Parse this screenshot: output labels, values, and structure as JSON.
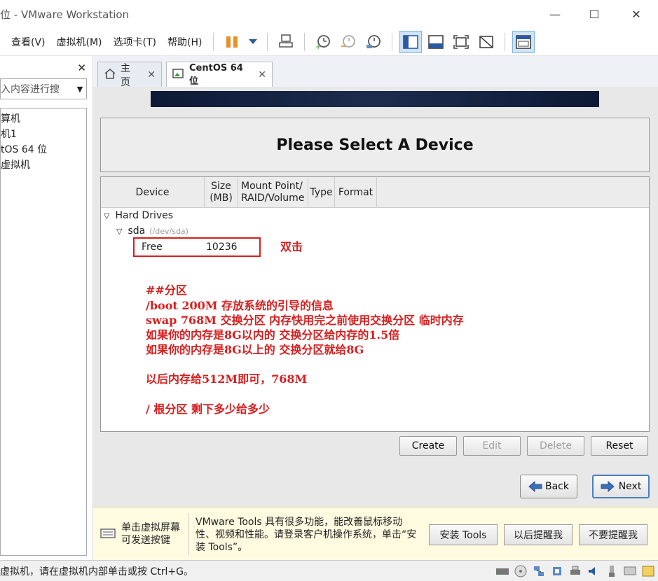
{
  "window": {
    "title": "位 - VMware Workstation",
    "minimize": "—",
    "maximize": "☐",
    "close": "✕"
  },
  "menu": [
    "查看(V)",
    "虚拟机(M)",
    "选项卡(T)",
    "帮助(H)"
  ],
  "library": {
    "search_placeholder": "入内容进行搜",
    "items": [
      "算机",
      "机1",
      "tOS 64 位",
      "虚拟机"
    ]
  },
  "tabs": [
    {
      "label": "主页"
    },
    {
      "label": "CentOS 64 位"
    }
  ],
  "installer": {
    "title": "Please Select A Device",
    "columns": {
      "device": "Device",
      "size": [
        "Size",
        "(MB)"
      ],
      "mount": [
        "Mount Point/",
        "RAID/Volume"
      ],
      "type": "Type",
      "format": "Format"
    },
    "tree": {
      "hard_drives": "Hard Drives",
      "disk": "sda",
      "disk_path": "(/dev/sda)",
      "free_label": "Free",
      "free_size": "10236"
    },
    "buttons": {
      "create": "Create",
      "edit": "Edit",
      "delete": "Delete",
      "reset": "Reset",
      "back": "Back",
      "next": "Next"
    }
  },
  "annotations": {
    "double_click": "双击",
    "lines": [
      "##分区",
      "/boot   200M 存放系统的引导的信息",
      "swap    768M 交换分区  内存快用完之前使用交换分区    临时内存",
      "如果你的内存是8G以内的 交换分区给内存的1.5倍",
      "如果你的内存是8G以上的 交换分区就给8G",
      "以后内存给512M即可，768M",
      "/           根分区    剩下多少给多少"
    ]
  },
  "notification": {
    "hint": [
      "单击虚拟屏幕",
      "可发送按键"
    ],
    "message": "VMware Tools 具有很多功能，能改善鼠标移动性、视频和性能。请登录客户机操作系统，单击“安装 Tools”。",
    "install": "安装 Tools",
    "remind_later": "以后提醒我",
    "never_remind": "不要提醒我"
  },
  "status": {
    "text": "虚拟机，请在虚拟机内部单击或按 Ctrl+G。"
  },
  "colors": {
    "annotation": "#d81e1e",
    "banner": "#0d1a35"
  }
}
